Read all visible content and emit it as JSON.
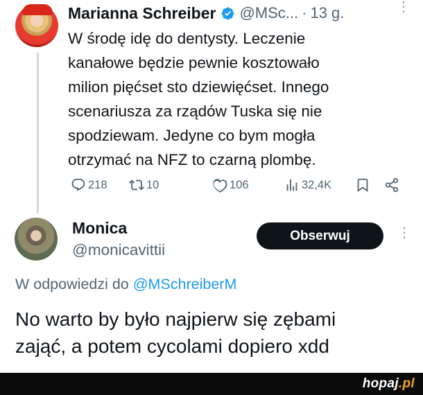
{
  "tweet1": {
    "name": "Marianna Schreiber",
    "handle": "@MSc...",
    "separator": "·",
    "time": "13 g.",
    "more": "⋮",
    "lines": [
      "W środę idę do dentysty. Leczenie",
      "kanałowe będzie pewnie kosztowało",
      "milion pięćset sto dziewięćset. Innego",
      "scenariusza za rządów Tuska się nie",
      "spodziewam. Jedyne co bym mogła",
      "otrzymać na NFZ to czarną plombę."
    ],
    "actions": {
      "replies": "218",
      "retweets": "10",
      "likes": "106",
      "views": "32,4K"
    }
  },
  "tweet2": {
    "name": "Monica",
    "handle": "@monicavittii",
    "follow_label": "Obserwuj",
    "more": "⋮",
    "reply_prefix": "W odpowiedzi do",
    "reply_mention": "@MSchreiberM",
    "lines": [
      "No warto by było najpierw się zębami",
      "zająć, a potem cycolami dopiero xdd"
    ]
  },
  "footer": {
    "brand_name": "hopaj",
    "brand_tld": ".pl"
  },
  "colors": {
    "text": "#0f1419",
    "secondary": "#536471",
    "link": "#1d9bf0",
    "verified": "#1d9bf0",
    "button_bg": "#0f1419",
    "brand_accent": "#f4a321"
  }
}
